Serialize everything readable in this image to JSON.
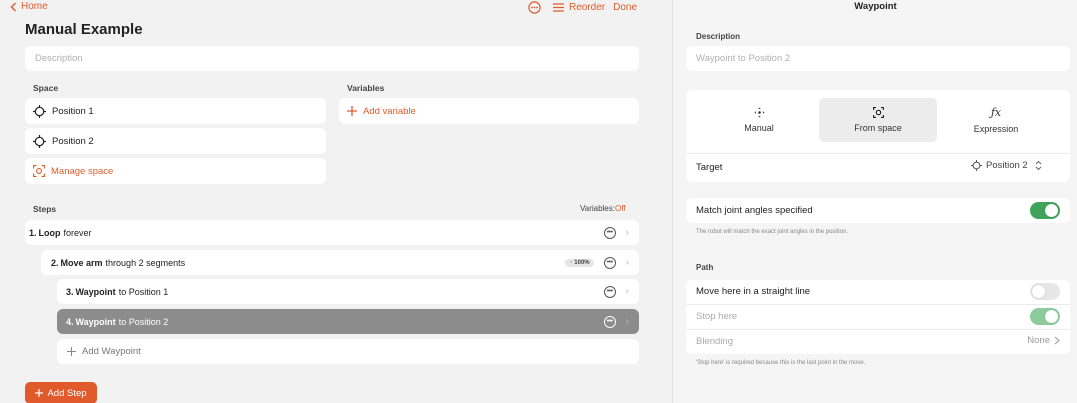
{
  "header": {
    "home_label": "Home",
    "reorder_label": "Reorder",
    "done_label": "Done"
  },
  "program": {
    "title": "Manual Example",
    "description_placeholder": "Description"
  },
  "space": {
    "label": "Space",
    "items": [
      {
        "label": "Position 1",
        "icon": "crosshair-icon"
      },
      {
        "label": "Position 2",
        "icon": "crosshair-icon"
      }
    ],
    "manage_label": "Manage space"
  },
  "variables": {
    "label": "Variables",
    "add_label": "Add variable"
  },
  "steps": {
    "label": "Steps",
    "variables_toggle_label": "Variables:",
    "variables_toggle_value": "Off",
    "items": [
      {
        "number": "1.",
        "name": "Loop",
        "detail": "forever"
      },
      {
        "number": "2.",
        "name": "Move arm",
        "detail": "through 2 segments",
        "badge": "100%"
      },
      {
        "number": "3.",
        "name": "Waypoint",
        "detail": "to Position 1"
      },
      {
        "number": "4.",
        "name": "Waypoint",
        "detail": "to Position 2"
      }
    ],
    "add_waypoint_label": "Add Waypoint",
    "add_step_label": "Add Step"
  },
  "waypoint": {
    "title": "Waypoint",
    "description_label": "Description",
    "description_placeholder": "Waypoint to Position 2",
    "modes": [
      {
        "label": "Manual",
        "icon": "move-icon"
      },
      {
        "label": "From space",
        "icon": "target-icon"
      },
      {
        "label": "Expression",
        "icon": "fx-icon"
      }
    ],
    "selected_mode": "From space",
    "target_label": "Target",
    "target_value": "Position 2",
    "match_joint_label": "Match joint angles specified",
    "match_joint_on": true,
    "match_joint_hint": "The robot will match the exact joint angles in the position.",
    "path_label": "Path",
    "straight_line_label": "Move here in a straight line",
    "straight_line_on": false,
    "stop_here_label": "Stop here",
    "stop_here_on": true,
    "blending_label": "Blending",
    "blending_value": "None",
    "path_hint": "'Stop here' is required because this is the last point in the move."
  },
  "colors": {
    "accent": "#e05a2b",
    "toggle_on": "#3fa35a",
    "toggle_on_disabled": "#8ccc9c",
    "selected_row": "#8c8c8c"
  }
}
